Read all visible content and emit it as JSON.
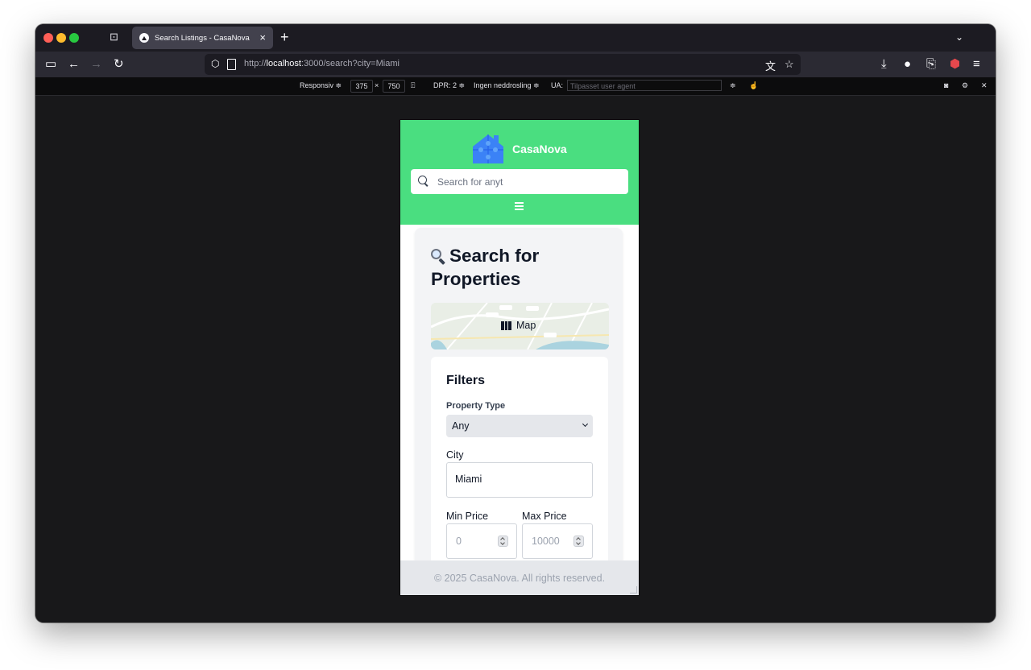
{
  "browser": {
    "tab_title": "Search Listings - CasaNova",
    "tab_close": "×",
    "new_tab": "+",
    "url_prefix": "http://",
    "url_host": "localhost",
    "url_path": ":3000/search?city=Miami"
  },
  "rdm": {
    "device": "Responsiv ≑",
    "width": "375",
    "times": "×",
    "height": "750",
    "dpr": "DPR: 2 ≑",
    "throttle": "Ingen neddrosling ≑",
    "ua_label": "UA:",
    "ua_placeholder": "Tilpasset user agent",
    "ua_arrow": "≑"
  },
  "site": {
    "brand": "CasaNova",
    "search_placeholder": "Search for anyt",
    "page_title": "Search for Properties",
    "map_label": "Map",
    "filters": {
      "title": "Filters",
      "property_type_label": "Property Type",
      "property_type_value": "Any",
      "city_label": "City",
      "city_value": "Miami",
      "min_price_label": "Min Price",
      "min_price_placeholder": "0",
      "max_price_label": "Max Price",
      "max_price_placeholder": "10000"
    },
    "footer": "© 2025 CasaNova. All rights reserved."
  },
  "colors": {
    "header_green": "#4ade80",
    "logo_blue": "#3b82f6"
  }
}
